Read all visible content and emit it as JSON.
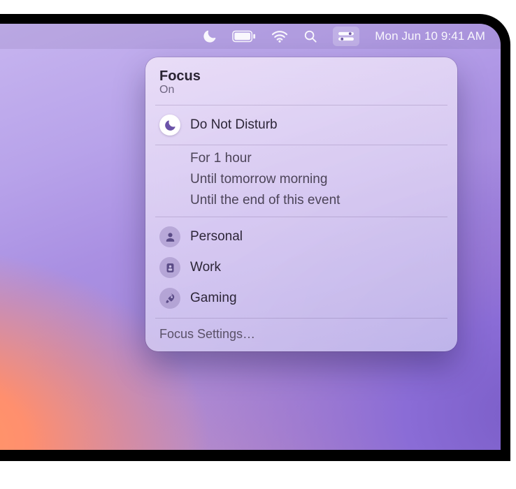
{
  "menubar": {
    "datetime": "Mon Jun 10  9:41 AM",
    "icons": {
      "focus": "moon-icon",
      "battery": "battery-icon",
      "wifi": "wifi-icon",
      "search": "search-icon",
      "control": "control-center-icon"
    }
  },
  "popover": {
    "title": "Focus",
    "status": "On",
    "dnd": {
      "label": "Do Not Disturb",
      "active": true,
      "durations": [
        "For 1 hour",
        "Until tomorrow morning",
        "Until the end of this event"
      ]
    },
    "modes": [
      {
        "icon": "person-icon",
        "label": "Personal"
      },
      {
        "icon": "badge-icon",
        "label": "Work"
      },
      {
        "icon": "rocket-icon",
        "label": "Gaming"
      }
    ],
    "settings_label": "Focus Settings…"
  },
  "colors": {
    "accent_purple": "#6b53a8",
    "icon_fill": "#5a4b86"
  }
}
